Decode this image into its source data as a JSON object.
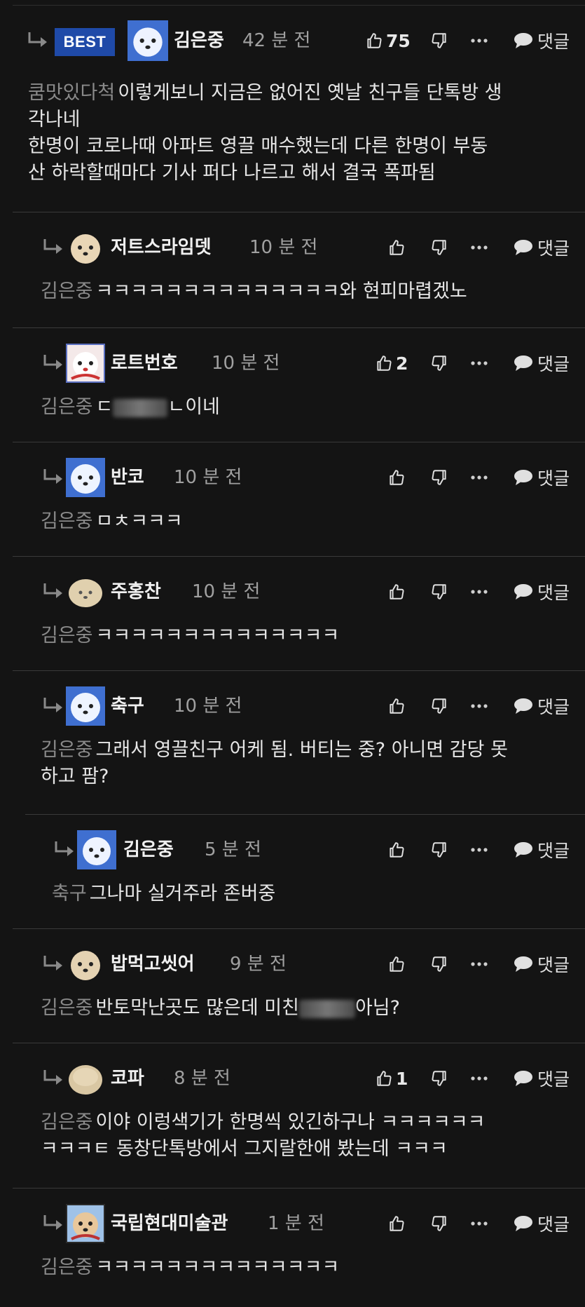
{
  "best_label": "BEST",
  "reply_label": "댓글",
  "comments": [
    {
      "name": "김은중",
      "time": "42 분 전",
      "likes": "75",
      "mention": "쿰맛있다척",
      "lines": [
        "이렇게보니 지금은 없어진 옛날 친구들 단톡방 생",
        "각나네",
        "한명이 코로나때 아파트 영끌 매수했는데 다른 한명이 부동",
        "산 하락할때마다 기사 퍼다 나르고 해서 결국 폭파됨"
      ]
    },
    {
      "name": "저트스라임뎃",
      "time": "10 분 전",
      "likes": "",
      "mention": "김은중",
      "lines": [
        "ㅋㅋㅋㅋㅋㅋㅋㅋㅋㅋㅋㅋㅋㅋ와 현피마렵겠노"
      ]
    },
    {
      "name": "로트번호",
      "time": "10 분 전",
      "likes": "2",
      "mention": "김은중",
      "pre": "ㄷ",
      "post": "ㄴ이네",
      "lines": []
    },
    {
      "name": "반코",
      "time": "10 분 전",
      "likes": "",
      "mention": "김은중",
      "lines": [
        "ㅁㅊㅋㅋㅋ"
      ]
    },
    {
      "name": "주홍찬",
      "time": "10 분 전",
      "likes": "",
      "mention": "김은중",
      "lines": [
        "ㅋㅋㅋㅋㅋㅋㅋㅋㅋㅋㅋㅋㅋㅋ"
      ]
    },
    {
      "name": "축구",
      "time": "10 분 전",
      "likes": "",
      "mention": "김은중",
      "lines": [
        "그래서 영끌친구 어케 됨. 버티는 중? 아니면 감당 못",
        "하고 팜?"
      ]
    },
    {
      "name": "김은중",
      "time": "5 분 전",
      "likes": "",
      "mention": "축구",
      "lines": [
        "그나마 실거주라 존버중"
      ]
    },
    {
      "name": "밥먹고씻어",
      "time": "9 분 전",
      "likes": "",
      "mention": "김은중",
      "pre": "반토막난곳도 많은데 미친",
      "post": "아님?",
      "lines": []
    },
    {
      "name": "코파",
      "time": "8 분 전",
      "likes": "1",
      "mention": "김은중",
      "lines": [
        "이야 이렁색기가 한명씩 있긴하구나 ㅋㅋㅋㅋㅋㅋ",
        "ㅋㅋㅋㅌ 동창단톡방에서 그지랄한애 봤는데 ㅋㅋㅋ"
      ]
    },
    {
      "name": "국립현대미술관",
      "time": "1 분 전",
      "likes": "",
      "mention": "김은중",
      "lines": [
        "ㅋㅋㅋㅋㅋㅋㅋㅋㅋㅋㅋㅋㅋㅋ"
      ]
    }
  ]
}
